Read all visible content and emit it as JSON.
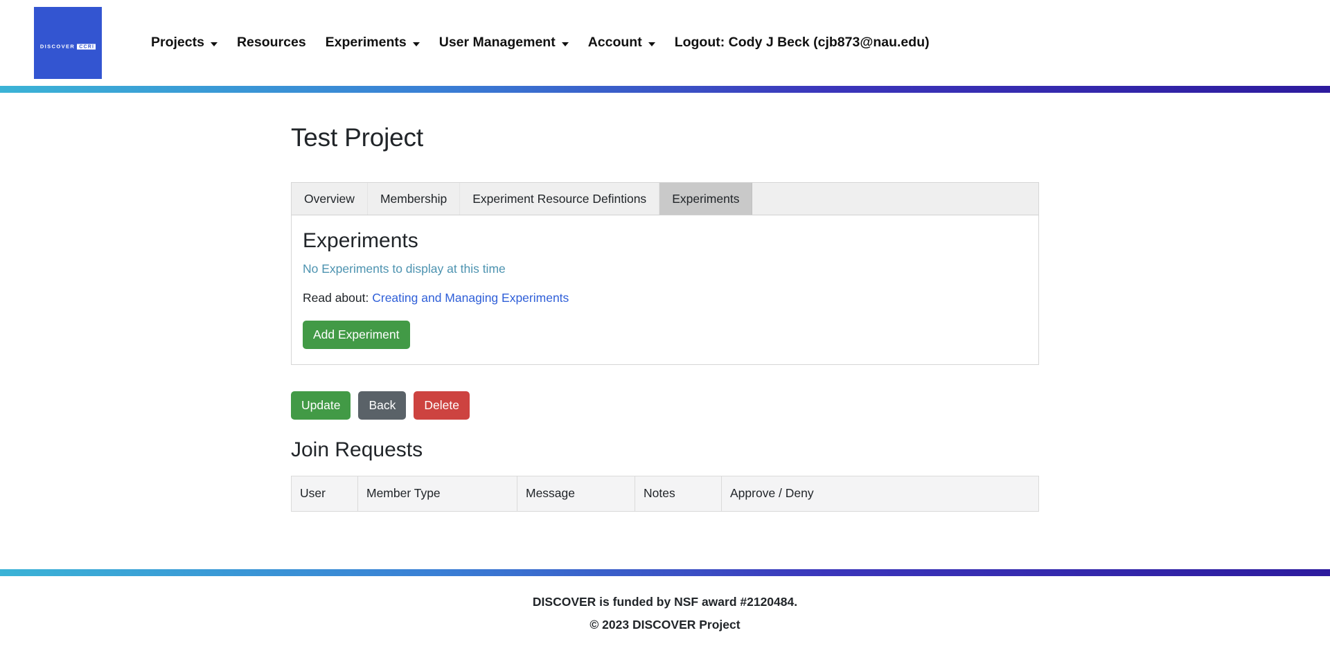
{
  "navbar": {
    "logo": {
      "word": "DISCOVER",
      "badge": "CCRI",
      "bg_color": "#3355d1"
    },
    "items": [
      {
        "label": "Projects",
        "caret": true
      },
      {
        "label": "Resources",
        "caret": false
      },
      {
        "label": "Experiments",
        "caret": true
      },
      {
        "label": "User Management",
        "caret": true
      },
      {
        "label": "Account",
        "caret": true
      },
      {
        "label": "Logout: Cody J Beck (cjb873@nau.edu)",
        "caret": false
      }
    ]
  },
  "accent": {
    "gradient_start": "#3bb3d6",
    "gradient_mid": "#3a7fd5",
    "gradient_end": "#2d1b9e",
    "green": "#429a46",
    "gray": "#5a6268",
    "red": "#cd4340",
    "link_blue": "#2f5fd8",
    "teal": "#4d93b0"
  },
  "main": {
    "page_title": "Test Project",
    "tabs": [
      {
        "label": "Overview",
        "active": false
      },
      {
        "label": "Membership",
        "active": false
      },
      {
        "label": "Experiment Resource Defintions",
        "active": false
      },
      {
        "label": "Experiments",
        "active": true
      }
    ],
    "panel": {
      "title": "Experiments",
      "empty_message": "No Experiments to display at this time",
      "read_about_prefix": "Read about:",
      "read_about_link": "Creating and Managing Experiments",
      "add_button": "Add Experiment"
    },
    "actions": [
      {
        "label": "Update",
        "style": "green"
      },
      {
        "label": "Back",
        "style": "gray"
      },
      {
        "label": "Delete",
        "style": "red"
      }
    ],
    "join_requests": {
      "title": "Join Requests",
      "columns": [
        "User",
        "Member Type",
        "Message",
        "Notes",
        "Approve / Deny"
      ],
      "rows": []
    }
  },
  "footer": {
    "funding_line": "DISCOVER is funded by NSF award #2120484.",
    "copyright_line": "© 2023 DISCOVER Project"
  }
}
